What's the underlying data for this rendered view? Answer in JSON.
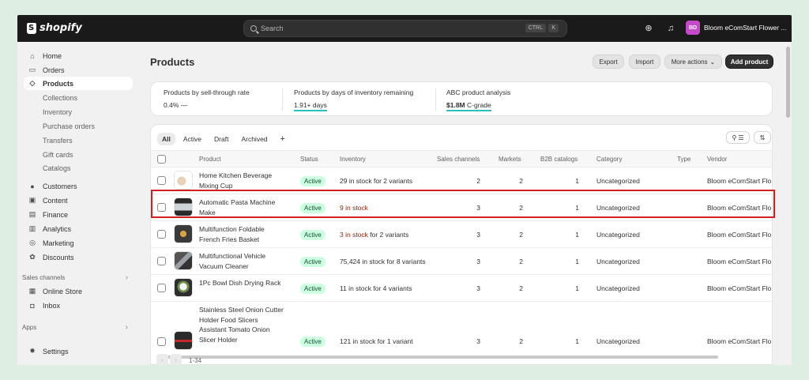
{
  "app": {
    "brand": "shopify",
    "search_placeholder": "Search",
    "shortcut_ctrl": "CTRL",
    "shortcut_k": "K",
    "store_initials": "BD",
    "store_name": "Bloom eComStart Flower ..."
  },
  "sidebar": {
    "items": [
      {
        "label": "Home",
        "icon": "home-icon",
        "glyph": "⌂"
      },
      {
        "label": "Orders",
        "icon": "inbox-icon",
        "glyph": "▭"
      },
      {
        "label": "Products",
        "icon": "tag-icon",
        "glyph": "◇"
      },
      {
        "label": "Collections"
      },
      {
        "label": "Inventory"
      },
      {
        "label": "Purchase orders"
      },
      {
        "label": "Transfers"
      },
      {
        "label": "Gift cards"
      },
      {
        "label": "Catalogs"
      },
      {
        "label": "Customers",
        "icon": "person-icon",
        "glyph": "●"
      },
      {
        "label": "Content",
        "icon": "image-icon",
        "glyph": "▣"
      },
      {
        "label": "Finance",
        "icon": "bank-icon",
        "glyph": "▤"
      },
      {
        "label": "Analytics",
        "icon": "chart-icon",
        "glyph": "▥"
      },
      {
        "label": "Marketing",
        "icon": "target-icon",
        "glyph": "◎"
      },
      {
        "label": "Discounts",
        "icon": "discount-icon",
        "glyph": "✿"
      }
    ],
    "sales_channels_label": "Sales channels",
    "channels": [
      {
        "label": "Online Store",
        "icon": "store-icon",
        "glyph": "▦"
      },
      {
        "label": "Inbox",
        "icon": "chat-icon",
        "glyph": "◘"
      }
    ],
    "apps_label": "Apps",
    "settings_label": "Settings"
  },
  "header": {
    "title": "Products",
    "export": "Export",
    "import": "Import",
    "more_actions": "More actions",
    "add_product": "Add product"
  },
  "metrics": [
    {
      "title": "Products by sell-through rate",
      "value": "0.4%",
      "extra": "—"
    },
    {
      "title": "Products by days of inventory remaining",
      "value": "1.91+ days"
    },
    {
      "title": "ABC product analysis",
      "value_bold": "$1.8M",
      "value": "C-grade"
    }
  ],
  "tabs": [
    "All",
    "Active",
    "Draft",
    "Archived",
    "+"
  ],
  "columns": [
    "Product",
    "Status",
    "Inventory",
    "Sales channels",
    "Markets",
    "B2B catalogs",
    "Category",
    "Type",
    "Vendor"
  ],
  "rows": [
    {
      "name": "Home Kitchen Beverage Mixing Cup",
      "status": "Active",
      "inv_red": "",
      "inventory": "29 in stock for 2 variants",
      "channels": "2",
      "markets": "2",
      "b2b": "1",
      "category": "Uncategorized",
      "vendor": "Bloom eComStart Flo"
    },
    {
      "name": "Automatic Pasta Machine Make",
      "status": "Active",
      "inv_red": "9 in stock",
      "inventory": "",
      "channels": "3",
      "markets": "2",
      "b2b": "1",
      "category": "Uncategorized",
      "vendor": "Bloom eComStart Flo"
    },
    {
      "name": "Multifunction Foldable French Fries Basket",
      "status": "Active",
      "inv_red": "3 in stock",
      "inventory": " for 2 variants",
      "channels": "3",
      "markets": "2",
      "b2b": "1",
      "category": "Uncategorized",
      "vendor": "Bloom eComStart Flo"
    },
    {
      "name": "Multifunctional Vehicle Vacuum Cleaner",
      "status": "Active",
      "inv_red": "",
      "inventory": "75,424 in stock for 8 variants",
      "channels": "3",
      "markets": "2",
      "b2b": "1",
      "category": "Uncategorized",
      "vendor": "Bloom eComStart Flo"
    },
    {
      "name": "1Pc Bowl Dish Drying Rack",
      "status": "Active",
      "inv_red": "",
      "inventory": "11 in stock for 4 variants",
      "channels": "3",
      "markets": "2",
      "b2b": "1",
      "category": "Uncategorized",
      "vendor": "Bloom eComStart Flo"
    },
    {
      "name": "Stainless Steel Onion Cutter Holder Food Slicers Assistant Tomato Onion Slicer Holder",
      "status": "Active",
      "inv_red": "",
      "inventory": "121 in stock for 1 variant",
      "channels": "3",
      "markets": "2",
      "b2b": "1",
      "category": "Uncategorized",
      "vendor": "Bloom eComStart Flo"
    }
  ],
  "pagination": {
    "range": "1-34",
    "prev": "‹",
    "next": "›"
  },
  "colors": {
    "accent_underline": "#2bc0c0",
    "active_badge_bg": "#cdfee1",
    "highlight_border": "#d31f1f",
    "low_stock_text": "#8e1f0b"
  }
}
